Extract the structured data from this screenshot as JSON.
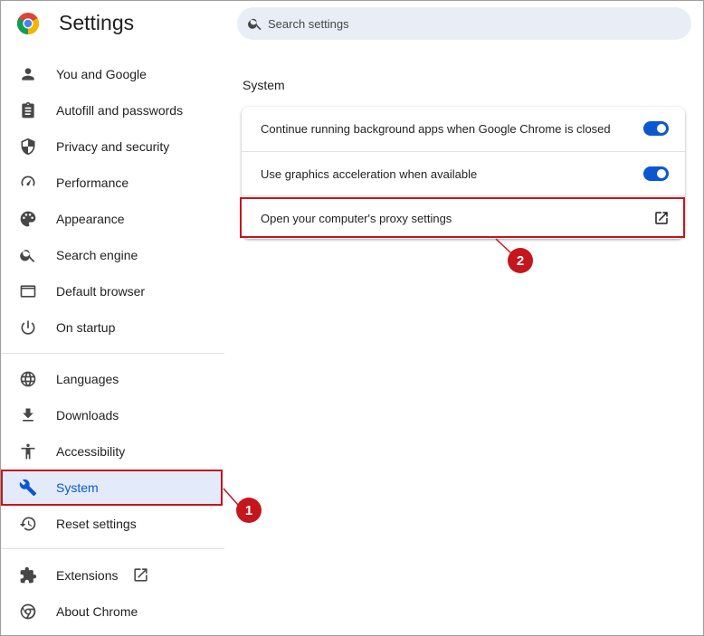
{
  "header": {
    "title": "Settings",
    "search_placeholder": "Search settings"
  },
  "sidebar": {
    "items": [
      {
        "label": "You and Google",
        "icon": "person-icon"
      },
      {
        "label": "Autofill and passwords",
        "icon": "clipboard-icon"
      },
      {
        "label": "Privacy and security",
        "icon": "shield-icon"
      },
      {
        "label": "Performance",
        "icon": "speedometer-icon"
      },
      {
        "label": "Appearance",
        "icon": "palette-icon"
      },
      {
        "label": "Search engine",
        "icon": "search-icon"
      },
      {
        "label": "Default browser",
        "icon": "browser-icon"
      },
      {
        "label": "On startup",
        "icon": "power-icon"
      },
      {
        "label": "Languages",
        "icon": "globe-icon"
      },
      {
        "label": "Downloads",
        "icon": "download-icon"
      },
      {
        "label": "Accessibility",
        "icon": "accessibility-icon"
      },
      {
        "label": "System",
        "icon": "wrench-icon",
        "selected": true
      },
      {
        "label": "Reset settings",
        "icon": "history-icon"
      },
      {
        "label": "Extensions",
        "icon": "puzzle-icon"
      },
      {
        "label": "About Chrome",
        "icon": "chrome-icon"
      }
    ]
  },
  "main": {
    "section_title": "System",
    "rows": [
      {
        "label": "Continue running background apps when Google Chrome is closed",
        "control": "toggle",
        "on": true
      },
      {
        "label": "Use graphics acceleration when available",
        "control": "toggle",
        "on": true
      },
      {
        "label": "Open your computer's proxy settings",
        "control": "launch-icon"
      }
    ]
  },
  "annotations": {
    "badge_1": "1",
    "badge_2": "2"
  },
  "colors": {
    "accent": "#0b57d0",
    "selected_bg": "#e3ebfb",
    "annotation_red": "#c4161c",
    "search_bg": "#e9eef6"
  }
}
